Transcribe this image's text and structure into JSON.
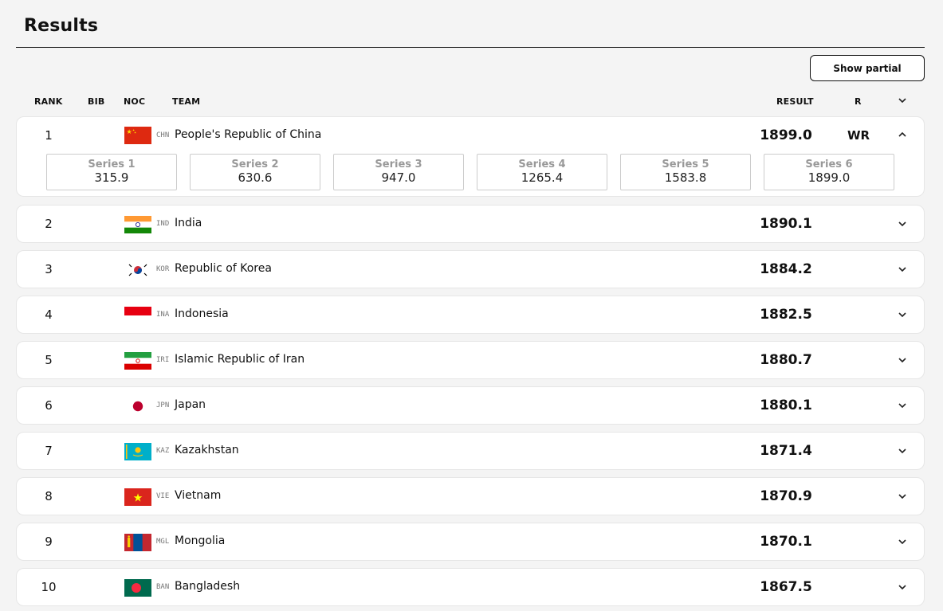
{
  "title": "Results",
  "show_partial_label": "Show partial",
  "columns": {
    "rank": "RANK",
    "bib": "BIB",
    "noc": "NOC",
    "team": "TEAM",
    "result": "RESULT",
    "record": "R"
  },
  "rows": [
    {
      "rank": "1",
      "noc": "CHN",
      "team": "People's Republic of China",
      "result": "1899.0",
      "record": "WR",
      "expanded": true,
      "flag": "flag-china",
      "series": [
        {
          "label": "Series 1",
          "value": "315.9"
        },
        {
          "label": "Series 2",
          "value": "630.6"
        },
        {
          "label": "Series 3",
          "value": "947.0"
        },
        {
          "label": "Series 4",
          "value": "1265.4"
        },
        {
          "label": "Series 5",
          "value": "1583.8"
        },
        {
          "label": "Series 6",
          "value": "1899.0"
        }
      ]
    },
    {
      "rank": "2",
      "noc": "IND",
      "team": "India",
      "result": "1890.1",
      "flag": "flag-india"
    },
    {
      "rank": "3",
      "noc": "KOR",
      "team": "Republic of Korea",
      "result": "1884.2",
      "flag": "flag-korea"
    },
    {
      "rank": "4",
      "noc": "INA",
      "team": "Indonesia",
      "result": "1882.5",
      "flag": "flag-indonesia"
    },
    {
      "rank": "5",
      "noc": "IRI",
      "team": "Islamic Republic of Iran",
      "result": "1880.7",
      "flag": "flag-iran"
    },
    {
      "rank": "6",
      "noc": "JPN",
      "team": "Japan",
      "result": "1880.1",
      "flag": "flag-japan"
    },
    {
      "rank": "7",
      "noc": "KAZ",
      "team": "Kazakhstan",
      "result": "1871.4",
      "flag": "flag-kazakhstan"
    },
    {
      "rank": "8",
      "noc": "VIE",
      "team": "Vietnam",
      "result": "1870.9",
      "flag": "flag-vietnam"
    },
    {
      "rank": "9",
      "noc": "MGL",
      "team": "Mongolia",
      "result": "1870.1",
      "flag": "flag-mongolia"
    },
    {
      "rank": "10",
      "noc": "BAN",
      "team": "Bangladesh",
      "result": "1867.5",
      "flag": "flag-bangladesh"
    }
  ]
}
